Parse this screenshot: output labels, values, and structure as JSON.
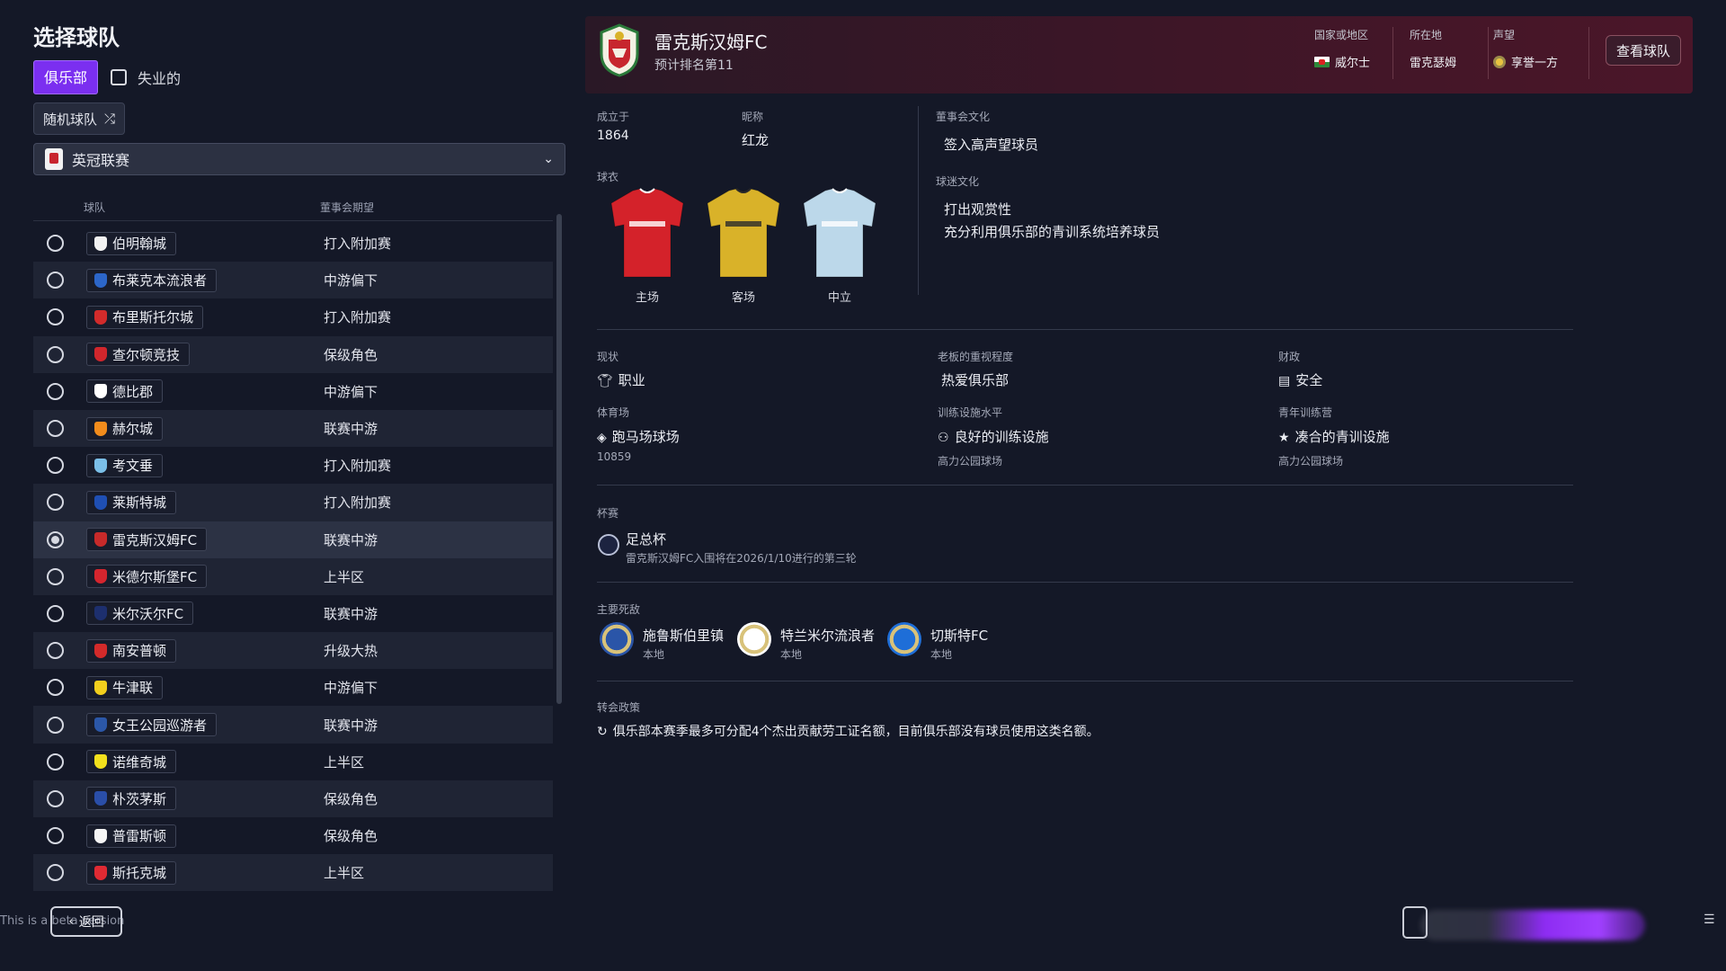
{
  "page": {
    "title": "选择球队",
    "club_tab": "俱乐部",
    "unemployed_label": "失业的",
    "random_label": "随机球队",
    "league": "英冠联赛",
    "col_team": "球队",
    "col_expectation": "董事会期望",
    "back_label": "返回",
    "beta_note": "This is a beta version"
  },
  "teams": [
    {
      "name": "伯明翰城",
      "expect": "打入附加赛",
      "color": "#f2f2f2"
    },
    {
      "name": "布莱克本流浪者",
      "expect": "中游偏下",
      "color": "#2c66c9"
    },
    {
      "name": "布里斯托尔城",
      "expect": "打入附加赛",
      "color": "#d22b2b"
    },
    {
      "name": "查尔顿竞技",
      "expect": "保级角色",
      "color": "#d1262c"
    },
    {
      "name": "德比郡",
      "expect": "中游偏下",
      "color": "#ffffff"
    },
    {
      "name": "赫尔城",
      "expect": "联赛中游",
      "color": "#f28c1c"
    },
    {
      "name": "考文垂",
      "expect": "打入附加赛",
      "color": "#7bbfe8"
    },
    {
      "name": "莱斯特城",
      "expect": "打入附加赛",
      "color": "#1f4fb3"
    },
    {
      "name": "雷克斯汉姆FC",
      "expect": "联赛中游",
      "color": "#c72a2a"
    },
    {
      "name": "米德尔斯堡FC",
      "expect": "上半区",
      "color": "#d5252e"
    },
    {
      "name": "米尔沃尔FC",
      "expect": "联赛中游",
      "color": "#1d2f6e"
    },
    {
      "name": "南安普顿",
      "expect": "升级大热",
      "color": "#d32a2a"
    },
    {
      "name": "牛津联",
      "expect": "中游偏下",
      "color": "#f2cf1d"
    },
    {
      "name": "女王公园巡游者",
      "expect": "联赛中游",
      "color": "#2b57a8"
    },
    {
      "name": "诺维奇城",
      "expect": "上半区",
      "color": "#f2e01d"
    },
    {
      "name": "朴茨茅斯",
      "expect": "保级角色",
      "color": "#2a4ea8"
    },
    {
      "name": "普雷斯顿",
      "expect": "保级角色",
      "color": "#f5f5f5"
    },
    {
      "name": "斯托克城",
      "expect": "上半区",
      "color": "#e02a33"
    }
  ],
  "selected_index": 8,
  "club": {
    "name": "雷克斯汉姆FC",
    "predicted": "预计排名第11",
    "country_label": "国家或地区",
    "country": "威尔士",
    "location_label": "所在地",
    "location": "雷克瑟姆",
    "reputation_label": "声望",
    "reputation": "享誉一方",
    "view_button": "查看球队",
    "founded_label": "成立于",
    "founded": "1864",
    "nickname_label": "昵称",
    "nickname": "红龙",
    "kits_label": "球衣",
    "kits": [
      {
        "label": "主场",
        "color": "#d4222a",
        "accent": "#ffffff"
      },
      {
        "label": "客场",
        "color": "#d9b229",
        "accent": "#2a2a2a"
      },
      {
        "label": "中立",
        "color": "#bcd8ea",
        "accent": "#ffffff"
      }
    ],
    "board_culture_label": "董事会文化",
    "board_culture": [
      "签入高声望球员"
    ],
    "fan_culture_label": "球迷文化",
    "fan_culture": [
      "打出观赏性",
      "充分利用俱乐部的青训系统培养球员"
    ],
    "status_label": "现状",
    "status": "职业",
    "owner_label": "老板的重视程度",
    "owner": "热爱俱乐部",
    "finance_label": "财政",
    "finance": "安全",
    "stadium_label": "体育场",
    "stadium": "跑马场球场",
    "capacity": "10859",
    "training_label": "训练设施水平",
    "training": "良好的训练设施",
    "training_ground": "高力公园球场",
    "youth_label": "青年训练营",
    "youth": "凑合的青训设施",
    "youth_ground": "高力公园球场",
    "cup_label": "杯赛",
    "cup_name": "足总杯",
    "cup_desc": "雷克斯汉姆FC入围将在2026/1/10进行的第三轮",
    "rivals_label": "主要死敌",
    "rivals": [
      {
        "name": "施鲁斯伯里镇",
        "tag": "本地",
        "color": "#2a55a8"
      },
      {
        "name": "特兰米尔流浪者",
        "tag": "本地",
        "color": "#ffffff"
      },
      {
        "name": "切斯特FC",
        "tag": "本地",
        "color": "#1e6ed8"
      }
    ],
    "transfer_label": "转会政策",
    "transfer_policy": "俱乐部本赛季最多可分配4个杰出贡献劳工证名额，目前俱乐部没有球员使用这类名额。"
  }
}
